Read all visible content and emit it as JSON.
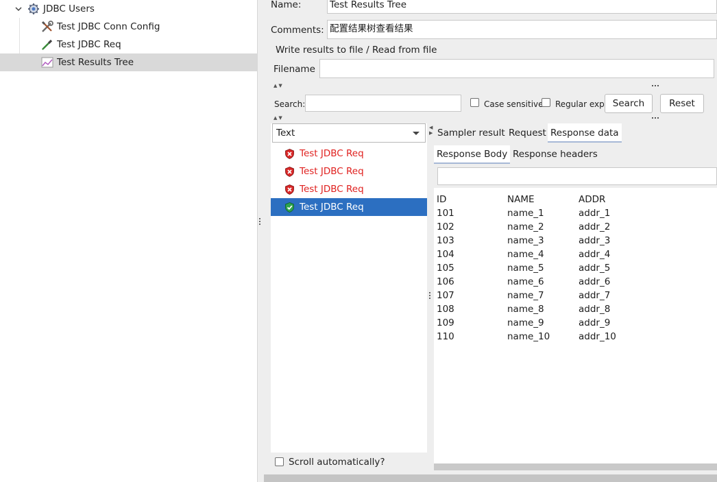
{
  "tree": {
    "items": [
      {
        "label": "JDBC Users",
        "icon": "gear-icon"
      },
      {
        "label": "Test JDBC Conn Config",
        "icon": "wrench-icon"
      },
      {
        "label": "Test JDBC Req",
        "icon": "pipette-icon"
      },
      {
        "label": "Test Results Tree",
        "icon": "chart-icon",
        "selected": true
      }
    ]
  },
  "form": {
    "name_label": "Name:",
    "name_value": "Test Results Tree",
    "comments_label": "Comments:",
    "comments_value": "配置结果树查看结果",
    "file_section_title": "Write results to file / Read from file",
    "filename_label": "Filename",
    "filename_value": ""
  },
  "search": {
    "label": "Search:",
    "value": "",
    "case_sensitive_label": "Case sensitive",
    "regex_label": "Regular exp.",
    "search_button": "Search",
    "reset_button": "Reset"
  },
  "results": {
    "renderer": "Text",
    "items": [
      {
        "label": "Test JDBC Req",
        "status": "error"
      },
      {
        "label": "Test JDBC Req",
        "status": "error"
      },
      {
        "label": "Test JDBC Req",
        "status": "error"
      },
      {
        "label": "Test JDBC Req",
        "status": "success",
        "selected": true
      }
    ],
    "scroll_auto_label": "Scroll automatically?"
  },
  "tabs": {
    "main": [
      "Sampler result",
      "Request",
      "Response data"
    ],
    "main_active": "Response data",
    "sub": [
      "Response Body",
      "Response headers"
    ],
    "sub_active": "Response Body"
  },
  "response": {
    "filter_value": "",
    "headers": [
      "ID",
      "NAME",
      "ADDR"
    ],
    "rows": [
      [
        "101",
        "name_1",
        "addr_1"
      ],
      [
        "102",
        "name_2",
        "addr_2"
      ],
      [
        "103",
        "name_3",
        "addr_3"
      ],
      [
        "104",
        "name_4",
        "addr_4"
      ],
      [
        "105",
        "name_5",
        "addr_5"
      ],
      [
        "106",
        "name_6",
        "addr_6"
      ],
      [
        "107",
        "name_7",
        "addr_7"
      ],
      [
        "108",
        "name_8",
        "addr_8"
      ],
      [
        "109",
        "name_9",
        "addr_9"
      ],
      [
        "110",
        "name_10",
        "addr_10"
      ]
    ]
  },
  "colors": {
    "error_text": "#e0211f",
    "selection": "#2c6fc1",
    "tree_selection": "#d9d9d9"
  }
}
